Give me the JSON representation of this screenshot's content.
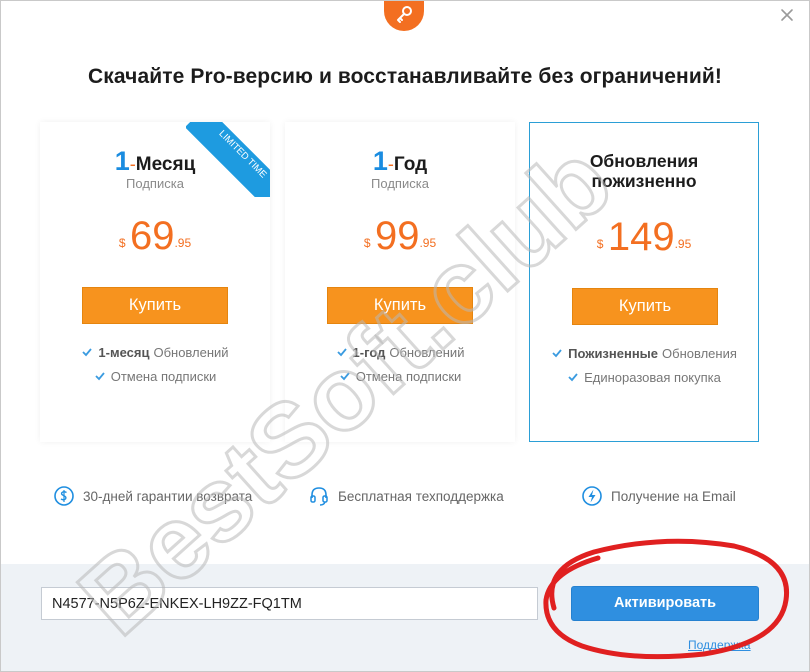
{
  "headline": "Скачайте Pro-версию и восстанавливайте без ограничений!",
  "plans": [
    {
      "num": "1",
      "dash": "-",
      "name": "Месяц",
      "subtitle": "Подписка",
      "currency": "$",
      "price_main": "69",
      "price_cents": ".95",
      "buy_label": "Купить",
      "ribbon": "LIMITED TIME",
      "features": [
        {
          "bold": "1-месяц",
          "text": "Обновлений"
        },
        {
          "bold": "",
          "text": "Отмена подписки"
        }
      ]
    },
    {
      "num": "1",
      "dash": "-",
      "name": "Год",
      "subtitle": "Подписка",
      "currency": "$",
      "price_main": "99",
      "price_cents": ".95",
      "buy_label": "Купить",
      "features": [
        {
          "bold": "1-год",
          "text": "Обновлений"
        },
        {
          "bold": "",
          "text": "Отмена подписки"
        }
      ]
    },
    {
      "title_line1": "Обновления",
      "title_line2": "пожизненно",
      "currency": "$",
      "price_main": "149",
      "price_cents": ".95",
      "buy_label": "Купить",
      "features": [
        {
          "bold": "Пожизненные",
          "text": "Обновления"
        },
        {
          "bold": "",
          "text": "Единоразовая покупка"
        }
      ]
    }
  ],
  "guarantees": [
    {
      "icon": "money-back-icon",
      "text": "30-дней гарантии возврата"
    },
    {
      "icon": "headset-icon",
      "text": "Бесплатная техподдержка"
    },
    {
      "icon": "lightning-email-icon",
      "text": "Получение на Email"
    }
  ],
  "footer": {
    "license_value": "N4577-N5P6Z-ENKEX-LH9ZZ-FQ1TM",
    "activate_label": "Активировать",
    "support_label": "Поддержка"
  },
  "watermark": "BestSoft.club",
  "colors": {
    "accent_orange": "#f36f21",
    "button_orange": "#f7931e",
    "accent_blue": "#1a8ce0",
    "activate_blue": "#2f8fe0",
    "annotation_red": "#e02020"
  }
}
